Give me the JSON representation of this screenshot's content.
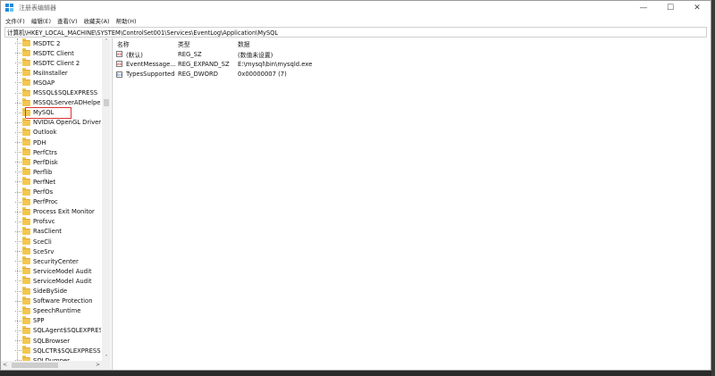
{
  "window": {
    "title": "注册表编辑器",
    "controls": {
      "minimize": "—",
      "maximize": "☐",
      "close": "✕"
    }
  },
  "menu": [
    "文件(F)",
    "编辑(E)",
    "查看(V)",
    "收藏夹(A)",
    "帮助(H)"
  ],
  "address": "计算机\\HKEY_LOCAL_MACHINE\\SYSTEM\\ControlSet001\\Services\\EventLog\\Application\\MySQL",
  "tree": {
    "items": [
      "MSDTC 2",
      "MSDTC Client",
      "MSDTC Client 2",
      "MsiInstaller",
      "MSOAP",
      "MSSQL$SQLEXPRESS",
      "MSSQLServerADHelper",
      "MySQL",
      "NVIDIA OpenGL Driver",
      "Outlook",
      "PDH",
      "PerfCtrs",
      "PerfDisk",
      "Perflib",
      "PerfNet",
      "PerfOs",
      "PerfProc",
      "Process Exit Monitor",
      "Profsvc",
      "RasClient",
      "SceCli",
      "SceSrv",
      "SecurityCenter",
      "ServiceModel Audit",
      "ServiceModel Audit",
      "SideBySide",
      "Software Protection",
      "SpeechRuntime",
      "SPP",
      "SQLAgent$SQLEXPRESS",
      "SQLBrowser",
      "SQLCTR$SQLEXPRESS",
      "SQLDumper"
    ],
    "selected": "MySQL"
  },
  "list": {
    "headers": {
      "name": "名称",
      "type": "类型",
      "data": "数据"
    },
    "rows": [
      {
        "icon": "ab",
        "name": "(默认)",
        "type": "REG_SZ",
        "data": "(数值未设置)"
      },
      {
        "icon": "ab",
        "name": "EventMessage...",
        "type": "REG_EXPAND_SZ",
        "data": "E:\\mysql\\bin\\mysqld.exe"
      },
      {
        "icon": "bin",
        "name": "TypesSupported",
        "type": "REG_DWORD",
        "data": "0x00000007 (7)"
      }
    ]
  },
  "scroll": {
    "up": "˄",
    "down": "˅",
    "left": "<",
    "right": ">"
  },
  "colors": {
    "selection_border": "#e03030",
    "folder": "#f3c74f"
  }
}
